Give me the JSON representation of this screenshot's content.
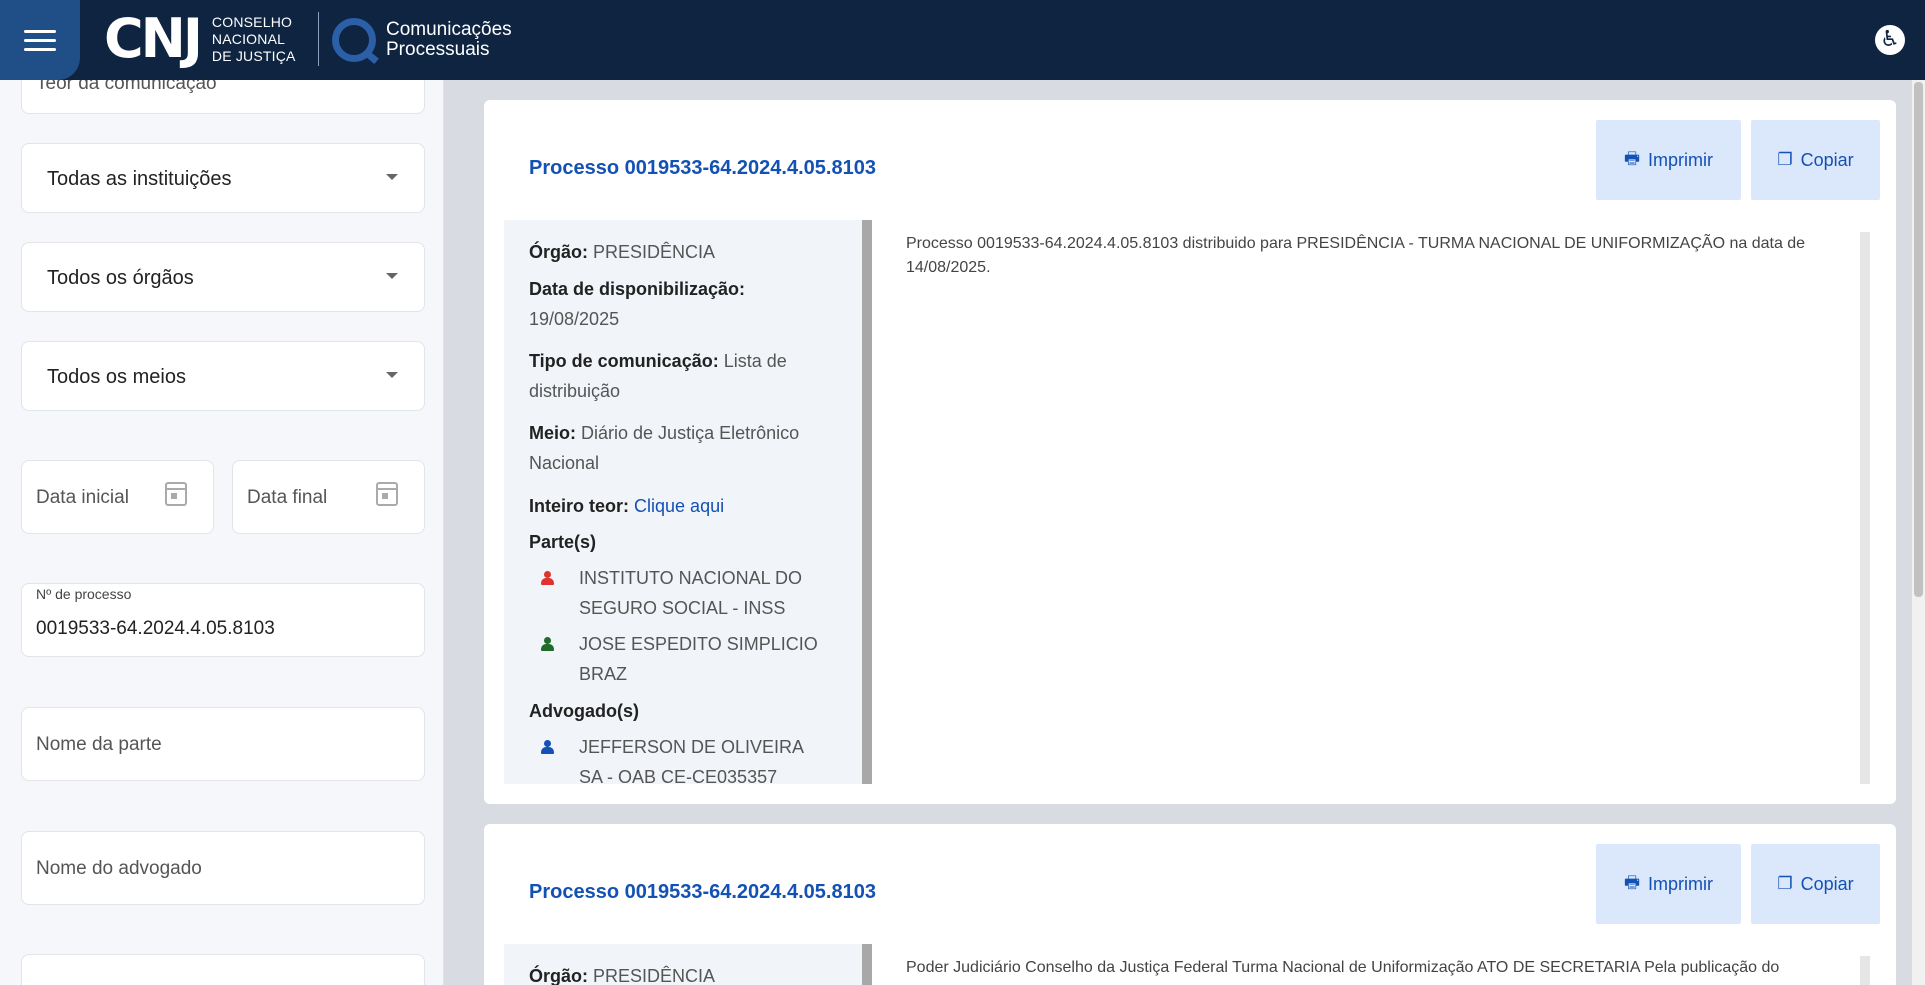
{
  "header": {
    "logo_mark": "CNJ",
    "logo_lines": [
      "CONSELHO",
      "NACIONAL",
      "DE JUSTIÇA"
    ],
    "product_lines": [
      "Comunicações",
      "Processuais"
    ],
    "accessibility_icon": "accessibility-icon",
    "menu_icon": "hamburger-icon"
  },
  "sidebar": {
    "teor_placeholder": "Teor da comunicação",
    "instituicoes": "Todas as instituições",
    "orgaos": "Todos os órgãos",
    "meios": "Todos os meios",
    "data_inicial": "Data inicial",
    "data_final": "Data final",
    "processo_label": "Nº de processo",
    "processo_value": "0019533-64.2024.4.05.8103",
    "nome_parte": "Nome da parte",
    "nome_advogado": "Nome do advogado"
  },
  "cards": [
    {
      "title": "Processo 0019533-64.2024.4.05.8103",
      "print_label": "Imprimir",
      "copy_label": "Copiar",
      "orgao_label": "Órgão:",
      "orgao": "PRESIDÊNCIA",
      "data_label": "Data de disponibilização:",
      "data": "19/08/2025",
      "tipo_label": "Tipo de comunicação:",
      "tipo_1": "Lista de",
      "tipo_2": "distribuição",
      "meio_label": "Meio:",
      "meio_1": "Diário de Justiça Eletrônico",
      "meio_2": "Nacional",
      "teor_label": "Inteiro teor:",
      "teor_link": "Clique aqui",
      "partes_label": "Parte(s)",
      "parte1_1": "INSTITUTO NACIONAL DO",
      "parte1_2": "SEGURO SOCIAL - INSS",
      "parte2_1": "JOSE ESPEDITO SIMPLICIO",
      "parte2_2": "BRAZ",
      "advogados_label": "Advogado(s)",
      "adv1_1": "JEFFERSON DE OLIVEIRA",
      "adv1_2": "SA - OAB CE-CE035357",
      "text_1": "Processo 0019533-64.2024.4.05.8103 distribuido para PRESIDÊNCIA - TURMA NACIONAL DE UNIFORMIZAÇÃO na data de",
      "text_2": "14/08/2025."
    },
    {
      "title": "Processo 0019533-64.2024.4.05.8103",
      "print_label": "Imprimir",
      "copy_label": "Copiar",
      "orgao_label": "Órgão:",
      "orgao": "PRESIDÊNCIA",
      "text_1": "Poder Judiciário Conselho da Justiça Federal Turma Nacional de Uniformização ATO DE SECRETARIA Pela publicação do"
    }
  ],
  "colors": {
    "header_bg": "#0e2440",
    "menu_btn": "#1f4f86",
    "link": "#1351b4",
    "button_bg": "#dbe8fb",
    "party_red": "#e0322f",
    "party_green": "#1e6b2a",
    "party_blue": "#1351b4"
  }
}
